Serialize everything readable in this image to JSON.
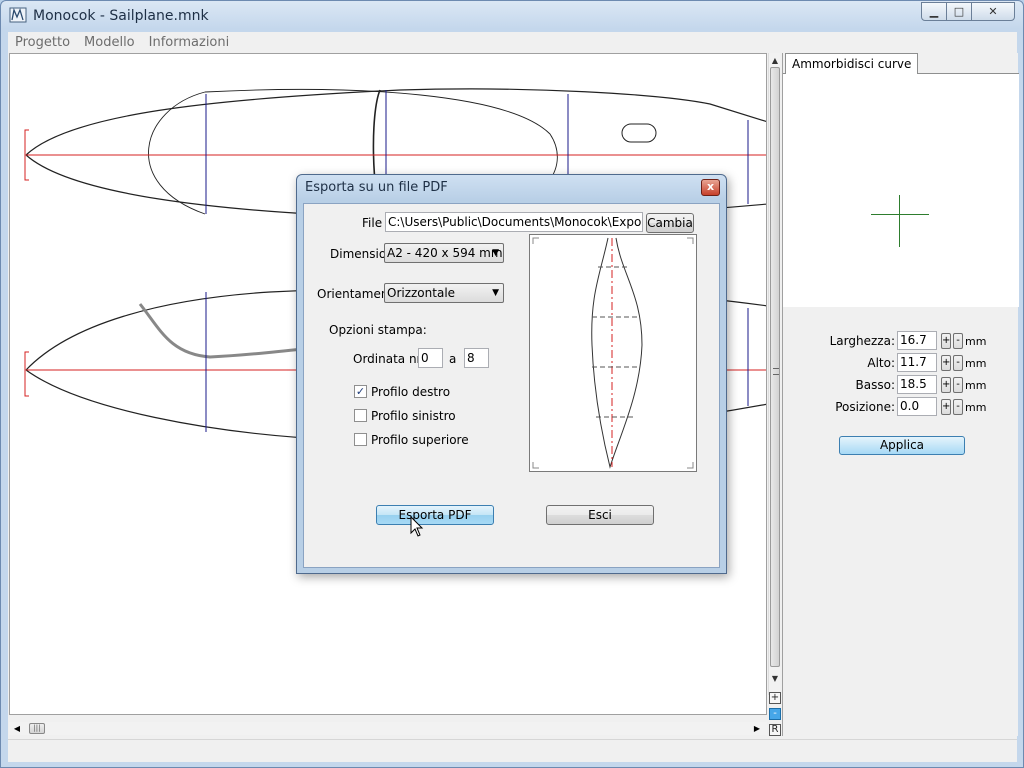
{
  "window": {
    "title": "Monocok - Sailplane.mnk",
    "controls": {
      "minimize": "▁",
      "maximize": "□",
      "close": "✕"
    }
  },
  "menu": [
    {
      "label": "Progetto"
    },
    {
      "label": "Modello"
    },
    {
      "label": "Informazioni"
    }
  ],
  "canvas": {
    "zoom_in": "+",
    "zoom_out": "-",
    "reset": "R"
  },
  "right_panel": {
    "tab_label": "Ammorbidisci curve",
    "fields": [
      {
        "label": "Larghezza:",
        "value": "16.7",
        "unit": "mm"
      },
      {
        "label": "Alto:",
        "value": "11.7",
        "unit": "mm"
      },
      {
        "label": "Basso:",
        "value": "18.5",
        "unit": "mm"
      },
      {
        "label": "Posizione:",
        "value": "0.0",
        "unit": "mm"
      }
    ],
    "plus": "+",
    "minus": "-",
    "apply_label": "Applica"
  },
  "dialog": {
    "title": "Esporta su un file PDF",
    "close": "x",
    "file_label": "File :",
    "file_value": "C:\\Users\\Public\\Documents\\Monocok\\Export.pdf",
    "change_label": "Cambia",
    "dimension_label": "Dimensioni:",
    "dimension_value": "A2 - 420 x 594 mm",
    "orientation_label": "Orientamento:",
    "orientation_value": "Orizzontale",
    "print_options_label": "Opzioni stampa:",
    "ordinate_label": "Ordinata nr.",
    "ordinate_from": "0",
    "ordinate_to_label": "a",
    "ordinate_to": "8",
    "checkboxes": [
      {
        "label": "Profilo destro",
        "checked": true
      },
      {
        "label": "Profilo sinistro",
        "checked": false
      },
      {
        "label": "Profilo superiore",
        "checked": false
      }
    ],
    "export_label": "Esporta PDF",
    "exit_label": "Esci"
  },
  "colors": {
    "centerline": "#d42020",
    "section_line": "#1a1a8a",
    "crosshair": "#2e7d2e",
    "accent": "#3c7fb1"
  }
}
